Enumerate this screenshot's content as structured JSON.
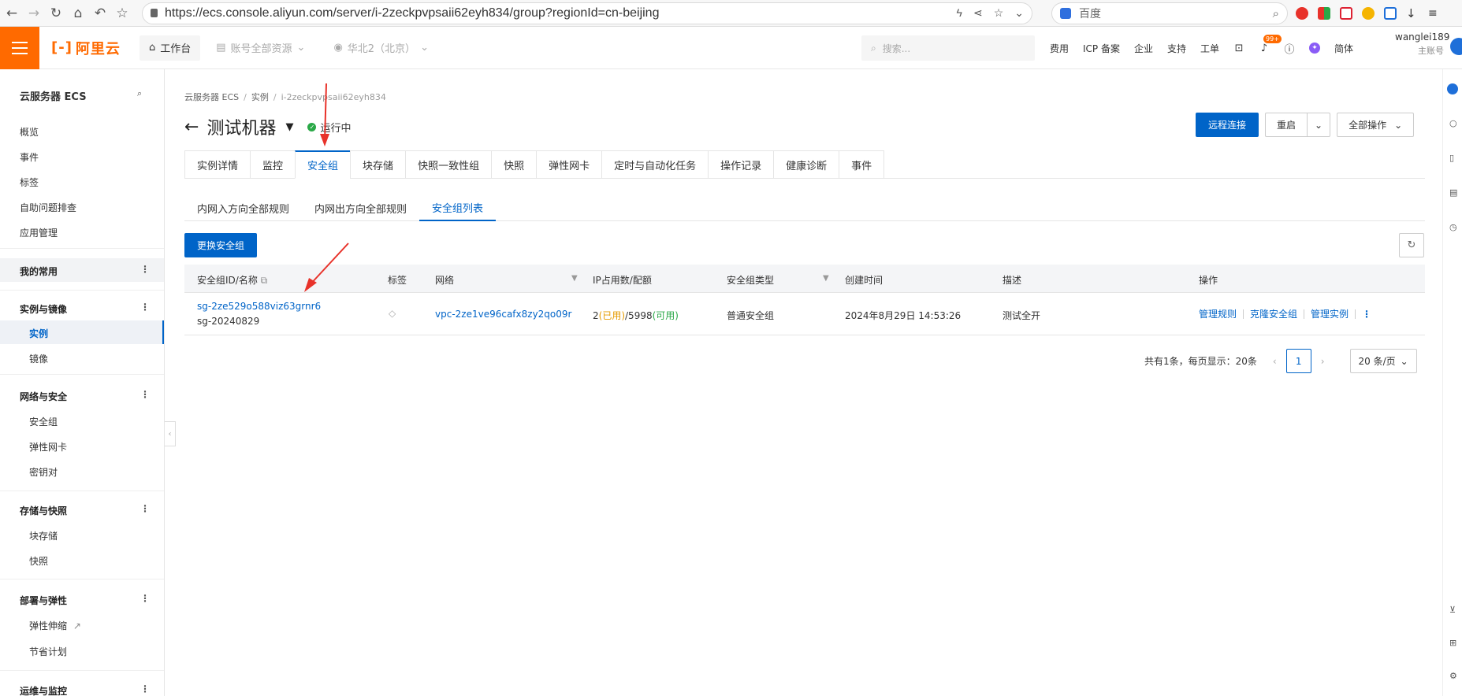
{
  "browser": {
    "url": "https://ecs.console.aliyun.com/server/i-2zeckpvpsaii62eyh834/group?regionId=cn-beijing",
    "search_engine": "百度"
  },
  "topnav": {
    "logo": "阿里云",
    "workbench": "工作台",
    "resources": "账号全部资源",
    "region": "华北2（北京）",
    "search_placeholder": "搜索...",
    "links": [
      "费用",
      "ICP 备案",
      "企业",
      "支持",
      "工单"
    ],
    "notif_badge": "99+",
    "lang": "简体",
    "user_name": "wanglei189",
    "user_role": "主账号"
  },
  "sidebar": {
    "title": "云服务器 ECS",
    "items": [
      "概览",
      "事件",
      "标签",
      "自助问题排查",
      "应用管理"
    ],
    "favorites": "我的常用",
    "groups": [
      {
        "title": "实例与镜像",
        "items": [
          "实例",
          "镜像"
        ]
      },
      {
        "title": "网络与安全",
        "items": [
          "安全组",
          "弹性网卡",
          "密钥对"
        ]
      },
      {
        "title": "存储与快照",
        "items": [
          "块存储",
          "快照"
        ]
      },
      {
        "title": "部署与弹性",
        "items": [
          "弹性伸缩",
          "节省计划"
        ]
      },
      {
        "title": "运维与监控",
        "items": []
      }
    ]
  },
  "breadcrumb": [
    "云服务器 ECS",
    "实例",
    "i-2zeckpvpsaii62eyh834"
  ],
  "page": {
    "title": "测试机器",
    "status": "运行中",
    "btn_remote": "远程连接",
    "btn_restart": "重启",
    "btn_all_ops": "全部操作"
  },
  "tabs": [
    "实例详情",
    "监控",
    "安全组",
    "块存储",
    "快照一致性组",
    "快照",
    "弹性网卡",
    "定时与自动化任务",
    "操作记录",
    "健康诊断",
    "事件"
  ],
  "subtabs": [
    "内网入方向全部规则",
    "内网出方向全部规则",
    "安全组列表"
  ],
  "table": {
    "change_btn": "更换安全组",
    "headers": [
      "安全组ID/名称",
      "标签",
      "网络",
      "IP占用数/配额",
      "安全组类型",
      "创建时间",
      "描述",
      "操作"
    ],
    "rows": [
      {
        "id": "sg-2ze529o588viz63grnr6",
        "name": "sg-20240829",
        "vpc": "vpc-2ze1ve96cafx8zy2qo09r",
        "ip_used": "2",
        "ip_used_label": "(已用)",
        "ip_quota": "/5998",
        "ip_avail_label": "(可用)",
        "type": "普通安全组",
        "created": "2024年8月29日 14:53:26",
        "desc": "测试全开",
        "op1": "管理规则",
        "op2": "克隆安全组",
        "op3": "管理实例"
      }
    ]
  },
  "pager": {
    "summary": "共有1条，每页显示：20条",
    "page": "1",
    "size": "20 条/页"
  },
  "colors": {
    "accent": "#0064c8",
    "brand": "#ff6a00",
    "running": "#2aa847",
    "annotation": "#e8322a"
  }
}
